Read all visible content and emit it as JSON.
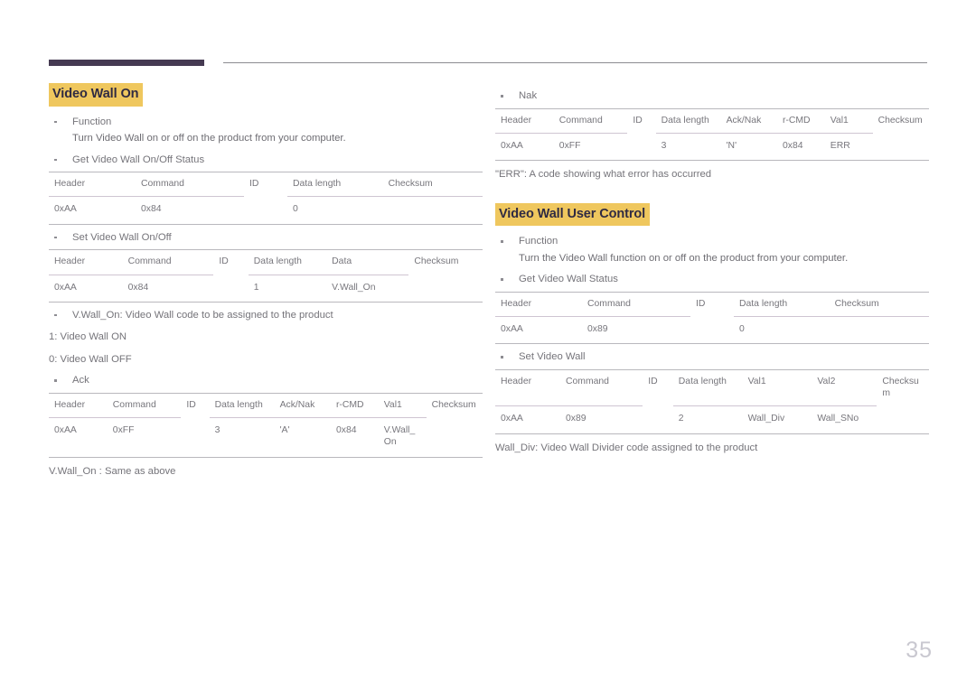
{
  "page": {
    "number": "35",
    "accent_bar_color": "#453a52",
    "highlight_color": "#efc75e",
    "heading_text_color": "#2f2a42"
  },
  "left_column": {
    "heading": "Video Wall On",
    "function_label": "Function",
    "function_text": "Turn Video Wall on or off on the product from your computer.",
    "get_label": "Get Video Wall On/Off Status",
    "get_table": {
      "headers": [
        "Header",
        "Command",
        "ID",
        "Data length",
        "Checksum"
      ],
      "row": [
        "0xAA",
        "0x84",
        "",
        "0",
        ""
      ]
    },
    "set_label": "Set Video Wall On/Off",
    "set_table": {
      "headers": [
        "Header",
        "Command",
        "ID",
        "Data length",
        "Data",
        "Checksum"
      ],
      "row": [
        "0xAA",
        "0x84",
        "",
        "1",
        "V.Wall_On",
        ""
      ]
    },
    "code_note": "V.Wall_On: Video Wall code to be assigned to the product",
    "code_on": "1: Video Wall ON",
    "code_off": "0: Video Wall OFF",
    "ack_label": "Ack",
    "ack_table": {
      "headers": [
        "Header",
        "Command",
        "ID",
        "Data length",
        "Ack/Nak",
        "r-CMD",
        "Val1",
        "Checksum"
      ],
      "row": [
        "0xAA",
        "0xFF",
        "",
        "3",
        "'A'",
        "0x84",
        "V.Wall_ On",
        ""
      ]
    },
    "ack_note": "V.Wall_On : Same as above"
  },
  "right_column": {
    "nak_label": "Nak",
    "nak_table": {
      "headers": [
        "Header",
        "Command",
        "ID",
        "Data length",
        "Ack/Nak",
        "r-CMD",
        "Val1",
        "Checksum"
      ],
      "row": [
        "0xAA",
        "0xFF",
        "",
        "3",
        "'N'",
        "0x84",
        "ERR",
        ""
      ]
    },
    "err_note": "\"ERR\": A code showing what error has occurred",
    "heading": "Video Wall User Control",
    "function_label": "Function",
    "function_text": "Turn the Video Wall function on or off on the product from your computer.",
    "get_label": "Get Video Wall Status",
    "get_table": {
      "headers": [
        "Header",
        "Command",
        "ID",
        "Data length",
        "Checksum"
      ],
      "row": [
        "0xAA",
        "0x89",
        "",
        "0",
        ""
      ]
    },
    "set_label": "Set Video Wall",
    "set_table": {
      "headers": [
        "Header",
        "Command",
        "ID",
        "Data length",
        "Val1",
        "Val2",
        "Checksum"
      ],
      "row": [
        "0xAA",
        "0x89",
        "",
        "2",
        "Wall_Div",
        "Wall_SNo",
        ""
      ]
    },
    "wall_div_note": "Wall_Div: Video Wall Divider code assigned to the product"
  }
}
